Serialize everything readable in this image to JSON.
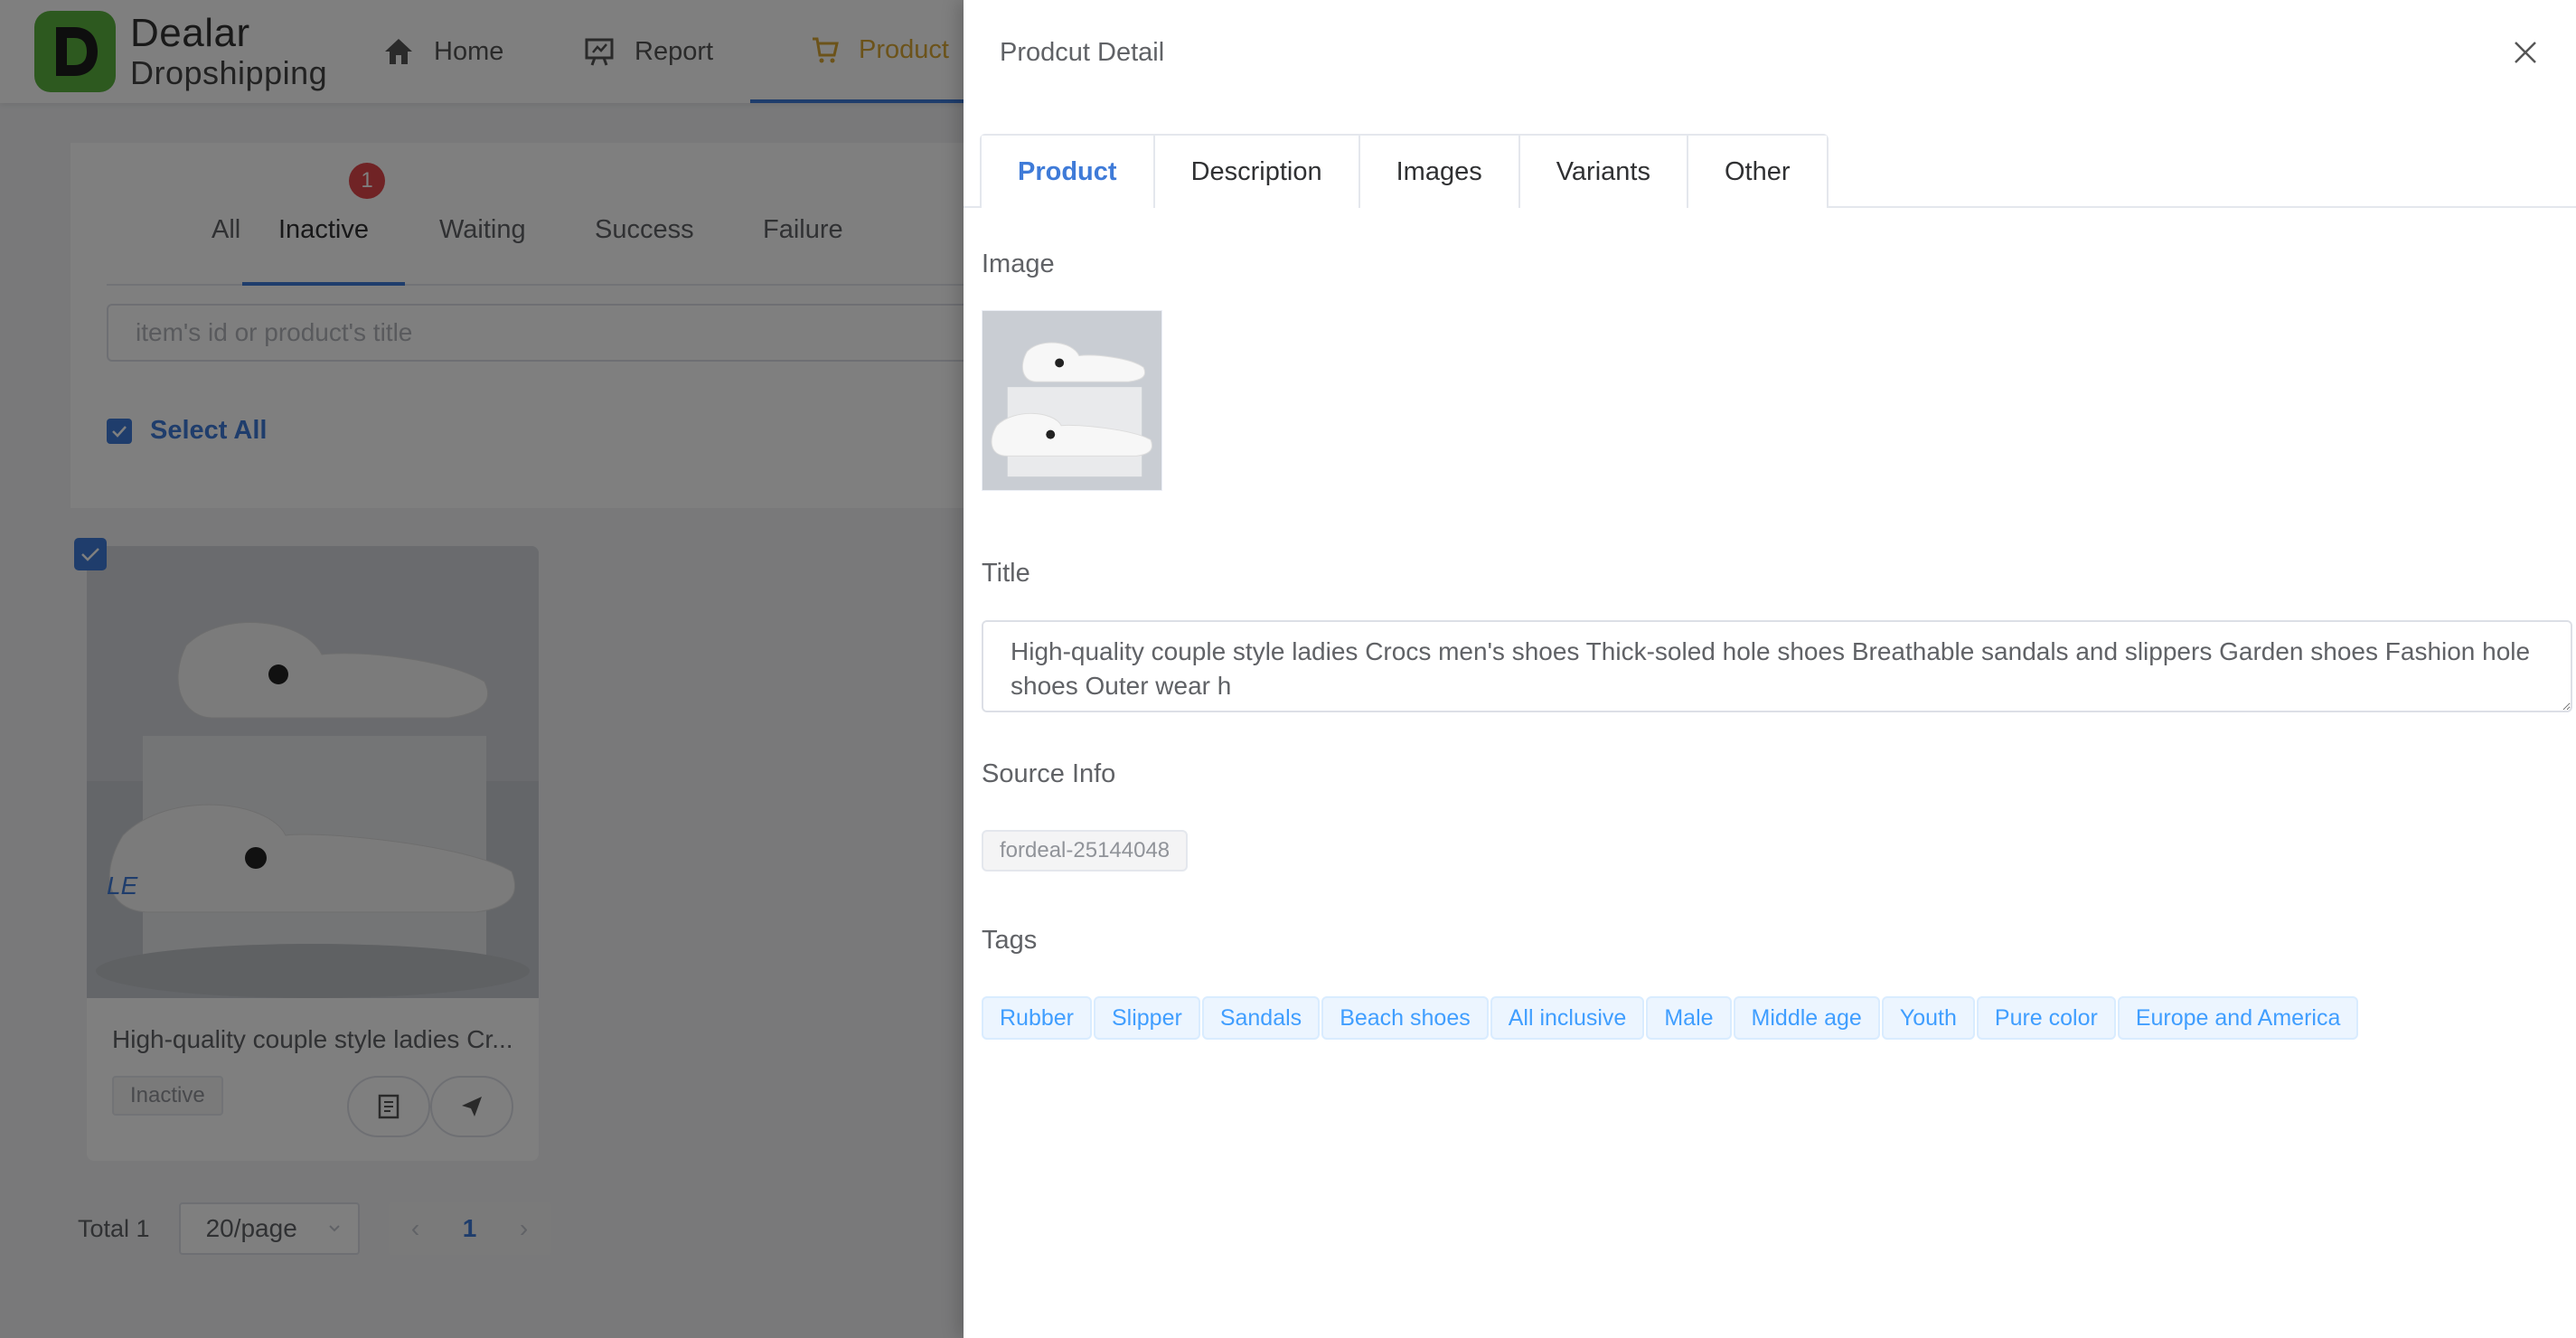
{
  "app": {
    "logo_line1": "Dealar",
    "logo_line2": "Dropshipping",
    "nav": {
      "home": "Home",
      "report": "Report",
      "product": "Product"
    }
  },
  "status_tabs": [
    "All",
    "Inactive",
    "Waiting",
    "Success",
    "Failure"
  ],
  "inactive_badge": "1",
  "search": {
    "placeholder": "item's id or product's title"
  },
  "select_all_label": "Select All",
  "product_card": {
    "title": "High-quality couple style ladies Cr...",
    "status": "Inactive"
  },
  "pagination": {
    "total": "Total 1",
    "page_size": "20/page",
    "current_page": "1",
    "prev": "‹",
    "next": "›"
  },
  "drawer": {
    "title": "Prodcut Detail",
    "tabs": [
      "Product",
      "Description",
      "Images",
      "Variants",
      "Other"
    ],
    "image_label": "Image",
    "title_label": "Title",
    "title_value": "High-quality couple style ladies Crocs men's shoes Thick-soled hole shoes Breathable sandals and slippers Garden shoes Fashion hole shoes Outer wear h",
    "source_label": "Source Info",
    "source_value": "fordeal-25144048",
    "tags_label": "Tags",
    "tags": [
      "Rubber",
      "Slipper",
      "Sandals",
      "Beach shoes",
      "All inclusive",
      "Male",
      "Middle age",
      "Youth",
      "Pure color",
      "Europe and America"
    ]
  },
  "colors": {
    "accent": "#3f7bd8",
    "brand_green": "#5bb33f",
    "active_nav": "#d8a635",
    "badge_red": "#e0474b",
    "tag_blue": "#409eff"
  }
}
